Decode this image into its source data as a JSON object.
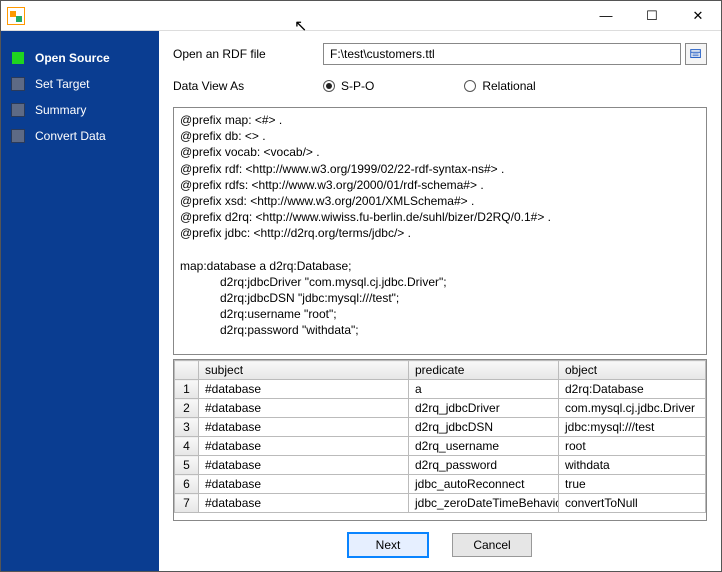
{
  "window": {
    "min": "—",
    "max": "☐",
    "close": "✕"
  },
  "sidebar": {
    "steps": [
      {
        "label": "Open Source",
        "active": true
      },
      {
        "label": "Set Target",
        "active": false
      },
      {
        "label": "Summary",
        "active": false
      },
      {
        "label": "Convert Data",
        "active": false
      }
    ]
  },
  "form": {
    "open_label": "Open an RDF file",
    "file_value": "F:\\test\\customers.ttl",
    "view_label": "Data View As",
    "radio_spo": "S-P-O",
    "radio_rel": "Relational",
    "selected": "spo"
  },
  "rdf_text": "@prefix map: <#> .\n@prefix db: <> .\n@prefix vocab: <vocab/> .\n@prefix rdf: <http://www.w3.org/1999/02/22-rdf-syntax-ns#> .\n@prefix rdfs: <http://www.w3.org/2000/01/rdf-schema#> .\n@prefix xsd: <http://www.w3.org/2001/XMLSchema#> .\n@prefix d2rq: <http://www.wiwiss.fu-berlin.de/suhl/bizer/D2RQ/0.1#> .\n@prefix jdbc: <http://d2rq.org/terms/jdbc/> .\n\nmap:database a d2rq:Database;\n            d2rq:jdbcDriver \"com.mysql.cj.jdbc.Driver\";\n            d2rq:jdbcDSN \"jdbc:mysql:///test\";\n            d2rq:username \"root\";\n            d2rq:password \"withdata\";",
  "table": {
    "headers": {
      "subject": "subject",
      "predicate": "predicate",
      "object": "object"
    },
    "rows": [
      {
        "n": "1",
        "s": "#database",
        "p": "a",
        "o": "d2rq:Database"
      },
      {
        "n": "2",
        "s": "#database",
        "p": "d2rq_jdbcDriver",
        "o": "com.mysql.cj.jdbc.Driver"
      },
      {
        "n": "3",
        "s": "#database",
        "p": "d2rq_jdbcDSN",
        "o": "jdbc:mysql:///test"
      },
      {
        "n": "4",
        "s": "#database",
        "p": "d2rq_username",
        "o": "root"
      },
      {
        "n": "5",
        "s": "#database",
        "p": "d2rq_password",
        "o": "withdata"
      },
      {
        "n": "6",
        "s": "#database",
        "p": "jdbc_autoReconnect",
        "o": "true"
      },
      {
        "n": "7",
        "s": "#database",
        "p": "jdbc_zeroDateTimeBehavior",
        "o": "convertToNull"
      }
    ]
  },
  "buttons": {
    "next": "Next",
    "cancel": "Cancel"
  }
}
